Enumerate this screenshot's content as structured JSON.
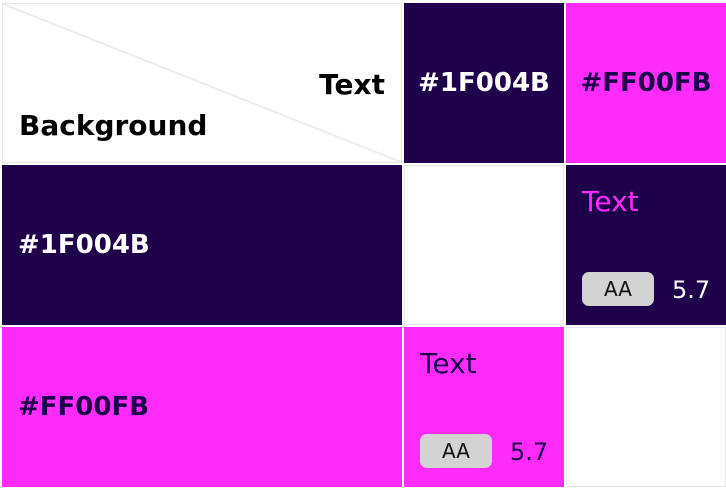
{
  "header": {
    "text_label": "Text",
    "background_label": "Background"
  },
  "columns": [
    {
      "label": "#1F004B",
      "color": "#1F004B",
      "text_color": "#FFFFFF"
    },
    {
      "label": "#FF00FB",
      "color": "#FF2BFA",
      "text_color": "#1F004B"
    }
  ],
  "rows": [
    {
      "label": "#1F004B",
      "color": "#1F004B",
      "text_color": "#FFFFFF"
    },
    {
      "label": "#FF00FB",
      "color": "#FF2BFA",
      "text_color": "#1F004B"
    }
  ],
  "cells": {
    "r1_c2": {
      "sample": "Text",
      "background": "#1F004B",
      "text_color": "#FF2BFA",
      "badge": "AA",
      "ratio": "5.7"
    },
    "r2_c1": {
      "sample": "Text",
      "background": "#FF2BFA",
      "text_color": "#1F004B",
      "badge": "AA",
      "ratio": "5.7"
    }
  }
}
